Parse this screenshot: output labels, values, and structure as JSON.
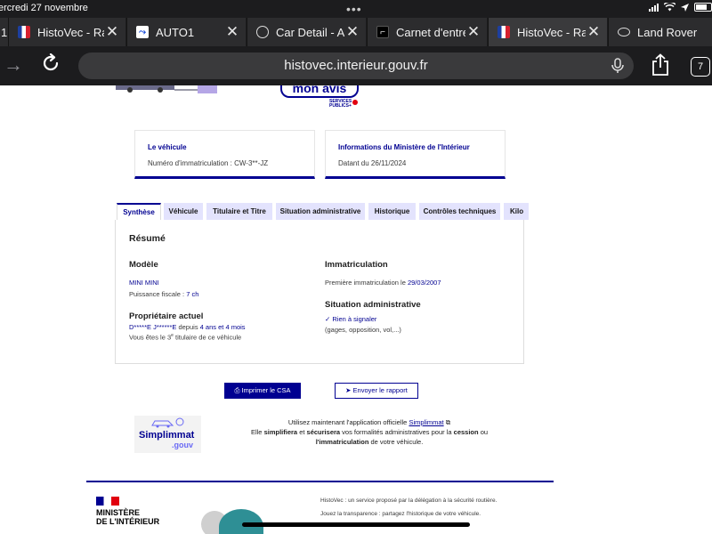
{
  "status": {
    "time": "ercredi 27 novembre"
  },
  "tabs": [
    {
      "title": "1",
      "icon": "generic"
    },
    {
      "title": "HistoVec - Rapp",
      "icon": "histovec-flag-icon"
    },
    {
      "title": "AUTO1",
      "icon": "auto1-icon"
    },
    {
      "title": "Car Detail - Adr",
      "icon": "globe-icon"
    },
    {
      "title": "Carnet d'entret",
      "icon": "carnet-icon"
    },
    {
      "title": "HistoVec - Rapp",
      "icon": "histovec-flag-icon"
    },
    {
      "title": "Land Rover",
      "icon": "land-rover-icon"
    }
  ],
  "address": {
    "url": "histovec.interieur.gouv.fr",
    "tab_count": "7"
  },
  "banner": {
    "avis": "mon avis",
    "services_publics": "SERVICES PUBLICS+"
  },
  "cards": [
    {
      "heading": "Le véhicule",
      "text": "Numéro d'immatriculation : CW-3**-JZ"
    },
    {
      "heading": "Informations du Ministère de l'Intérieur",
      "text": "Datant du 26/11/2024"
    }
  ],
  "page_tabs": [
    "Synthèse",
    "Véhicule",
    "Titulaire et Titre",
    "Situation administrative",
    "Historique",
    "Contrôles techniques",
    "Kilo"
  ],
  "summary": {
    "title": "Résumé",
    "modele": {
      "heading": "Modèle",
      "name": "MINI MINI",
      "puissance_label": "Puissance fiscale :",
      "puissance": "7 ch"
    },
    "proprietaire": {
      "heading": "Propriétaire actuel",
      "name": "D*****E J******E",
      "since_label": "depuis",
      "since": "4 ans et 4 mois",
      "rank_prefix": "Vous êtes le",
      "rank": "3",
      "rank_sup": "e",
      "rank_suffix": "titulaire de ce véhicule"
    },
    "immatriculation": {
      "heading": "Immatriculation",
      "label": "Première immatriculation le",
      "date": "29/03/2007"
    },
    "situation": {
      "heading": "Situation administrative",
      "status": "Rien à signaler",
      "detail": "(gages, opposition, vol,...)"
    }
  },
  "actions": {
    "print": "Imprimer le CSA",
    "send": "Envoyer le rapport"
  },
  "simplimmat": {
    "logo_word": "Simplimmat",
    "logo_domain": ".gouv",
    "line1_a": "Utilisez maintenant l'application officielle",
    "line1_link": "Simplimmat",
    "line2_a": "Elle",
    "line2_b": "simplifiera",
    "line2_c": "et",
    "line2_d": "sécurisera",
    "line2_e": "vos formalités administratives pour la",
    "line2_f": "cession",
    "line2_g": "ou",
    "line3_a": "l'immatriculation",
    "line3_b": "de votre véhicule."
  },
  "footer": {
    "ministere_1": "MINISTÈRE",
    "ministere_2": "DE L'INTÉRIEUR",
    "text1": "HistoVec : un service proposé par la délégation à la sécurité routière.",
    "text2": "Jouez la transparence : partagez l'historique de votre véhicule."
  }
}
